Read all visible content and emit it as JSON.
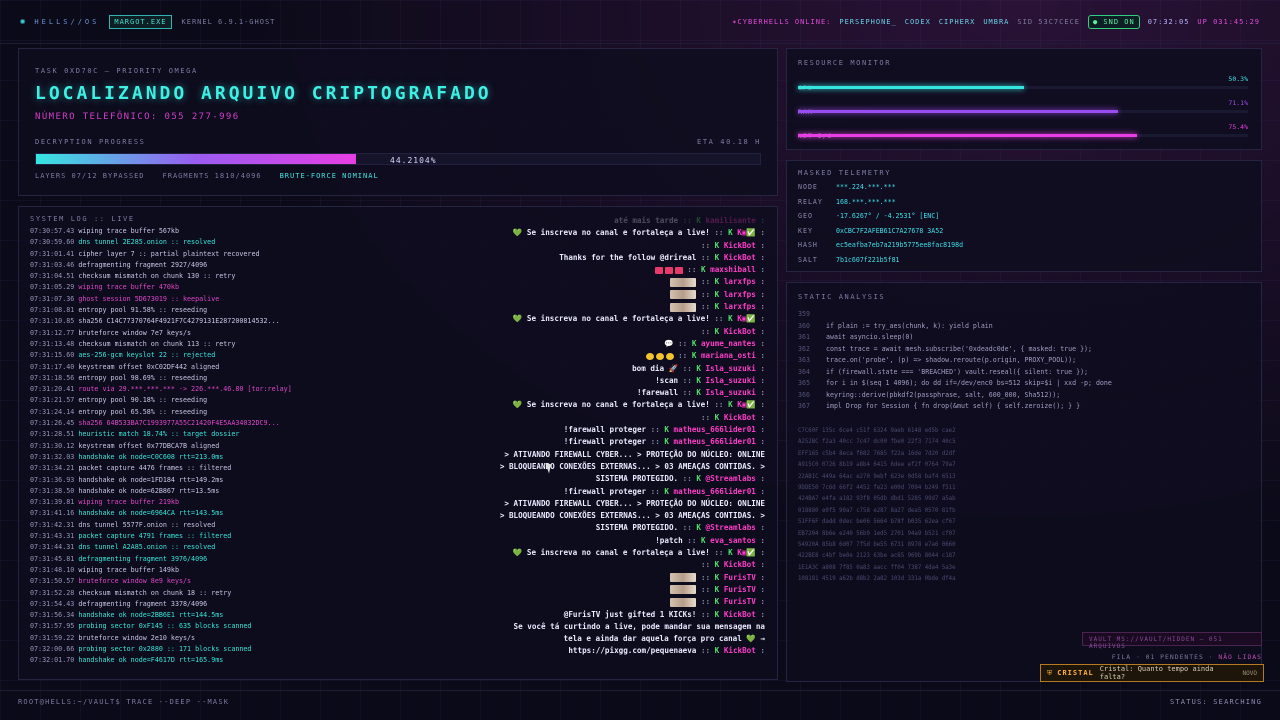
{
  "topbar": {
    "logo": "✺",
    "brand": "HELLS//OS",
    "process": "MARGOT.EXE",
    "kernel": "KERNEL 6.9.1-GHOST",
    "online_label": "CYBERHELLS ONLINE:",
    "online_users": [
      "PERSEPHONE_",
      "CODEX",
      "CIPHERX",
      "UMBRA"
    ],
    "sid": "SID 53C7CECE",
    "snd": "● SND ON",
    "clock": "07:32:05",
    "uptime": "UP 031:45:29"
  },
  "task": {
    "label": "TASK 0XD70C — PRIORITY OMEGA",
    "title": "LOCALIZANDO ARQUIVO CRIPTOGRAFADO",
    "phone": "NÚMERO TELEFÔNICO: 055 277-996",
    "progress_label": "DECRYPTION PROGRESS",
    "eta": "ETA 40.18 H",
    "progress_text": "44.2104%",
    "progress": 44.21,
    "layers": "LAYERS 07/12 BYPASSED",
    "fragments": "FRAGMENTS 1810/4096",
    "status": "BRUTE-FORCE NOMINAL"
  },
  "log": {
    "header": "SYSTEM LOG :: LIVE",
    "lines": [
      {
        "t": "07:30:57.43",
        "m": "wiping trace buffer 567kb",
        "c": "lc"
      },
      {
        "t": "07:30:59.60",
        "m": "dns tunnel 2E285.onion :: resolved",
        "c": "lcy"
      },
      {
        "t": "07:31:01.41",
        "m": "cipher layer 7 :: partial plaintext recovered",
        "c": "lc"
      },
      {
        "t": "07:31:03.46",
        "m": "defragmenting fragment 2927/4096",
        "c": "lc"
      },
      {
        "t": "07:31:04.51",
        "m": "checksum mismatch on chunk 130 :: retry",
        "c": "lc"
      },
      {
        "t": "07:31:05.29",
        "m": "wiping trace buffer 470kb",
        "c": "lm"
      },
      {
        "t": "07:31:07.36",
        "m": "ghost session 5D673019 :: keepalive",
        "c": "lm"
      },
      {
        "t": "07:31:08.81",
        "m": "entropy pool 91.58% :: reseeding",
        "c": "lc"
      },
      {
        "t": "07:31:10.85",
        "m": "sha256 C14C77370764F4921F7C4279131E287200814532...",
        "c": "lc"
      },
      {
        "t": "07:31:12.77",
        "m": "bruteforce window 7e7 keys/s",
        "c": "lc"
      },
      {
        "t": "07:31:13.48",
        "m": "checksum mismatch on chunk 113 :: retry",
        "c": "lc"
      },
      {
        "t": "07:31:15.60",
        "m": "aes-256-gcm keyslot 22 :: rejected",
        "c": "lcy"
      },
      {
        "t": "07:31:17.40",
        "m": "keystream offset 0xC02DF442 aligned",
        "c": "lc"
      },
      {
        "t": "07:31:18.56",
        "m": "entropy pool 98.69% :: reseeding",
        "c": "lc"
      },
      {
        "t": "07:31:20.41",
        "m": "route via 29.***.***.*** -> 226.***.46.80 [tor:relay]",
        "c": "lm"
      },
      {
        "t": "07:31:21.57",
        "m": "entropy pool 90.18% :: reseeding",
        "c": "lc"
      },
      {
        "t": "07:31:24.14",
        "m": "entropy pool 65.58% :: reseeding",
        "c": "lc"
      },
      {
        "t": "07:31:26.45",
        "m": "sha256 64B533BA7C1993977A55C21420F4E5AA34032DC9...",
        "c": "lm"
      },
      {
        "t": "07:31:28.51",
        "m": "heuristic match 18.74% :: target dossier",
        "c": "lcy"
      },
      {
        "t": "07:31:30.12",
        "m": "keystream offset 0x77DBCA7B aligned",
        "c": "lc"
      },
      {
        "t": "07:31:32.03",
        "m": "handshake ok node=C0C608 rtt=213.0ms",
        "c": "lcy"
      },
      {
        "t": "07:31:34.21",
        "m": "packet capture 4476 frames :: filtered",
        "c": "lc"
      },
      {
        "t": "07:31:36.93",
        "m": "handshake ok node=1FD184 rtt=149.2ms",
        "c": "lc"
      },
      {
        "t": "07:31:38.50",
        "m": "handshake ok node=62B867 rtt=13.5ms",
        "c": "lc"
      },
      {
        "t": "07:31:39.81",
        "m": "wiping trace buffer 219kb",
        "c": "lm"
      },
      {
        "t": "07:31:41.16",
        "m": "handshake ok node=6964CA rtt=143.5ms",
        "c": "lcy"
      },
      {
        "t": "07:31:42.31",
        "m": "dns tunnel 5577F.onion :: resolved",
        "c": "lc"
      },
      {
        "t": "07:31:43.31",
        "m": "packet capture 4791 frames :: filtered",
        "c": "lcy"
      },
      {
        "t": "07:31:44.31",
        "m": "dns tunnel A2A85.onion :: resolved",
        "c": "lcy"
      },
      {
        "t": "07:31:45.81",
        "m": "defragmenting fragment 3976/4096",
        "c": "lcy"
      },
      {
        "t": "07:31:48.10",
        "m": "wiping trace buffer 149kb",
        "c": "lc"
      },
      {
        "t": "07:31:50.57",
        "m": "bruteforce window 8e9 keys/s",
        "c": "lm"
      },
      {
        "t": "07:31:52.28",
        "m": "checksum mismatch on chunk 18 :: retry",
        "c": "lc"
      },
      {
        "t": "07:31:54.43",
        "m": "defragmenting fragment 3378/4096",
        "c": "lc"
      },
      {
        "t": "07:31:56.34",
        "m": "handshake ok node=2BB6E1 rtt=144.5ms",
        "c": "lcy"
      },
      {
        "t": "07:31:57.95",
        "m": "probing sector 0xF145 :: 635 blocks scanned",
        "c": "lcy"
      },
      {
        "t": "07:31:59.22",
        "m": "bruteforce window 2e10 keys/s",
        "c": "lc"
      },
      {
        "t": "07:32:00.66",
        "m": "probing sector 0x2880 :: 171 blocks scanned",
        "c": "lcy"
      },
      {
        "t": "07:32:01.70",
        "m": "handshake ok node=F4617D rtt=165.9ms",
        "c": "lcy"
      }
    ]
  },
  "chat": [
    {
      "msg": "até mais tarde",
      "user": "kamilisante",
      "fade": true
    },
    {
      "msg": "💚 Se inscreva no canal e fortaleça a live!",
      "user": "K▣✅"
    },
    {
      "msg": "",
      "user": "KickBot"
    },
    {
      "msg": "Thanks for the follow @drireal",
      "user": "KickBot"
    },
    {
      "msg": "",
      "user": "maxshiball",
      "emote": "red"
    },
    {
      "msg": "",
      "user": "larxfps",
      "emote": "pic"
    },
    {
      "msg": "",
      "user": "larxfps",
      "emote": "pic"
    },
    {
      "msg": "",
      "user": "larxfps",
      "emote": "pic"
    },
    {
      "msg": "💚 Se inscreva no canal e fortaleça a live!",
      "user": "K▣✅"
    },
    {
      "msg": "",
      "user": "KickBot"
    },
    {
      "msg": "💬",
      "user": "ayume_nantes"
    },
    {
      "msg": "",
      "user": "mariana_osti",
      "emote": "yellow"
    },
    {
      "msg": "bom dia 🚀",
      "user": "Isla_suzuki"
    },
    {
      "msg": "!scan",
      "user": "Isla_suzuki"
    },
    {
      "msg": "!farewall",
      "user": "Isla_suzuki"
    },
    {
      "msg": "💚 Se inscreva no canal e fortaleça a live!",
      "user": "K▣✅"
    },
    {
      "msg": "",
      "user": "KickBot"
    },
    {
      "msg": "!farewall proteger",
      "user": "matheus_666lider01"
    },
    {
      "msg": "!firewall proteger",
      "user": "matheus_666lider01"
    },
    {
      "msg": "> ATIVANDO FIREWALL CYBER... > PROTEÇÃO DO NÚCLEO: ONLINE",
      "user": ""
    },
    {
      "msg": "> BLOQUEANDO CONEXÕES EXTERNAS... > 03 AMEAÇAS CONTIDAS. >",
      "user": ""
    },
    {
      "msg": "SISTEMA PROTEGIDO.",
      "user": "@Streamlabs"
    },
    {
      "msg": "!firewall proteger",
      "user": "matheus_666lider01"
    },
    {
      "msg": "> ATIVANDO FIREWALL CYBER... > PROTEÇÃO DO NÚCLEO: ONLINE",
      "user": ""
    },
    {
      "msg": "> BLOQUEANDO CONEXÕES EXTERNAS... > 03 AMEAÇAS CONTIDAS. >",
      "user": ""
    },
    {
      "msg": "SISTEMA PROTEGIDO.",
      "user": "@Streamlabs"
    },
    {
      "msg": "!patch",
      "user": "eva_santos"
    },
    {
      "msg": "💚 Se inscreva no canal e fortaleça a live!",
      "user": "K▣✅"
    },
    {
      "msg": "",
      "user": "KickBot"
    },
    {
      "msg": "",
      "user": "FurisTV",
      "emote": "pic"
    },
    {
      "msg": "",
      "user": "FurisTV",
      "emote": "pic"
    },
    {
      "msg": "",
      "user": "FurisTV",
      "emote": "pic"
    },
    {
      "msg": "@FurisTV just gifted 1 KICKs!",
      "user": "KickBot"
    },
    {
      "msg": "Se você tá curtindo a live, pode mandar sua mensagem na",
      "user": ""
    },
    {
      "msg": "tela e ainda dar aquela força pro canal 💚 →",
      "user": ""
    },
    {
      "msg": "https://pixgg.com/pequenaeva",
      "user": "KickBot"
    }
  ],
  "resources": {
    "header": "RESOURCE MONITOR",
    "items": [
      {
        "name": "CPU",
        "pct_text": "50.3%",
        "pct": 50.3,
        "color": "#35e6e0"
      },
      {
        "name": "RAM",
        "pct_text": "71.1%",
        "pct": 71.1,
        "color": "#9a4cf0"
      },
      {
        "name": "NET I/O",
        "pct_text": "75.4%",
        "pct": 75.4,
        "color": "#e83ee4"
      }
    ]
  },
  "telemetry": {
    "header": "MASKED TELEMETRY",
    "rows": [
      {
        "k": "NODE",
        "v": "***.224.***.***"
      },
      {
        "k": "RELAY",
        "v": "168.***.***.***"
      },
      {
        "k": "GEO",
        "v": "-17.6267° / -4.2531° [ENC]"
      },
      {
        "k": "KEY",
        "v": "0xCBC7F2AFEB61C7A27678 3A52"
      },
      {
        "k": "HASH",
        "v": "ec5eafba7eb7a219b5775ee8fac8198d"
      },
      {
        "k": "SALT",
        "v": "7b1c607f221b5f81"
      }
    ]
  },
  "static": {
    "header": "STATIC ANALYSIS",
    "code": [
      {
        "n": "359",
        "s": ""
      },
      {
        "n": "360",
        "s": "if plain := try_aes(chunk, k): yield plain"
      },
      {
        "n": "361",
        "s": "await asyncio.sleep(0)"
      },
      {
        "n": "362",
        "s": "const trace = await mesh.subscribe('0xdeadc0de', { masked: true });"
      },
      {
        "n": "363",
        "s": "trace.on('probe', (p) => shadow.reroute(p.origin, PROXY_POOL));"
      },
      {
        "n": "364",
        "s": "if (firewall.state === 'BREACHED') vault.reseal({ silent: true });"
      },
      {
        "n": "365",
        "s": "for i in $(seq 1 4096); do dd if=/dev/enc0 bs=512 skip=$i | xxd -p; done"
      },
      {
        "n": "366",
        "s": "keyring::derive(pbkdf2(passphrase, salt, 600_000, Sha512));"
      },
      {
        "n": "367",
        "s": "impl Drop for Session { fn drop(&mut self) { self.zeroize(); } }"
      }
    ],
    "hex": [
      "C7C60F 135c 6ce4 c51f 6324 9aeb 6148 ed5b cae2",
      "A252BC f2a3 40cc 7c47 dc00 fbe0 22f3 7174 40c5",
      "EFF165 c5b4 8eca f682 7685 f22a 16de 7d20 d2df",
      "A915C0 0726 8b19 a8b4 6415 6dee ef2f 0764 79a7",
      "22AB1C 449a 64ac e270 9ebf 623e 0d58 baf4 6513",
      "9DDE50 7c6d 66f2 4452 fe23 e00d 7094 b249 f511",
      "424BA7 e4fa a182 93f8 05db dbd1 5285 99d7 a5ab",
      "018880 e0f5 90a7 c758 e287 8a27 dea5 0570 81fb",
      "51FF6F dadd 0dec be06 5664 b78f b035 62ea cf67",
      "EB7204 8b6e e240 56b9 1ed5 2701 94a9 b521 cf07",
      "54920A 85b8 6d07 7f5d be55 6731 8978 e7a6 0660",
      "422BE8 c4bf be0e 2123 63be ac65 969b 8044 c187",
      "1E1A3C a808 7f85 0a83 aacc ff04 7387 4da4 5a3e",
      "108181 4519 a62b d8b2 2a82 103d 331a 0bde df4a"
    ]
  },
  "vault": "VAULT MS://VAULT/HIDDEN — 051 ARQUIVOS",
  "fila": {
    "label": "FILA · 01 PENDENTES",
    "pending": "NÃO LIDAS"
  },
  "toast": {
    "icon": "⛨",
    "name": "CRISTAL",
    "msg": "Cristal: Quanto tempo ainda falta?",
    "tag": "NOVO"
  },
  "bottom": {
    "cmd": "ROOT@HELLS:~/VAULT$ TRACE --DEEP --MASK",
    "status": "STATUS: SEARCHING"
  }
}
